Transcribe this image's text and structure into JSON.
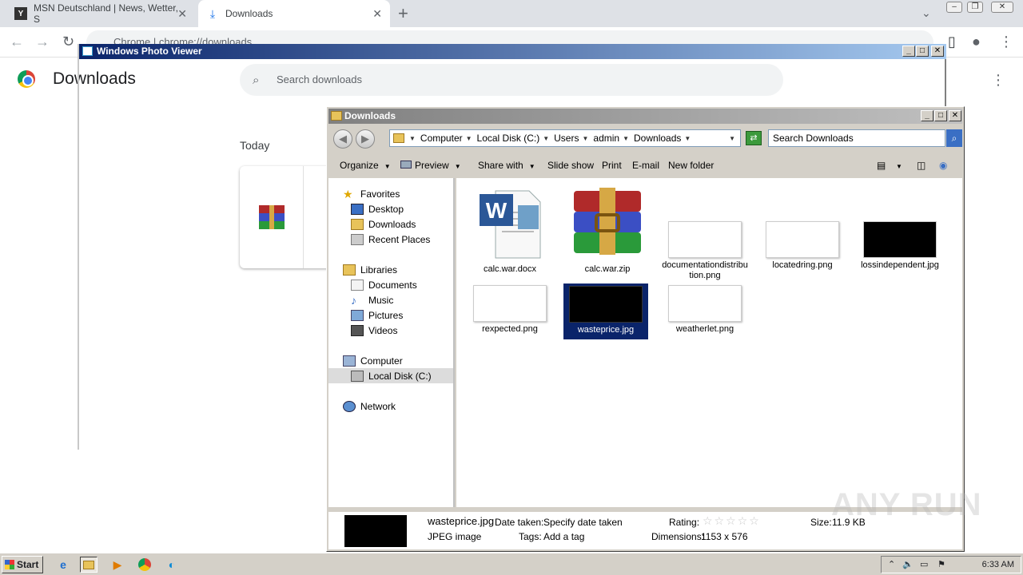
{
  "browser": {
    "tabs": [
      {
        "title": "MSN Deutschland | News, Wetter, S",
        "active": false
      },
      {
        "title": "Downloads",
        "active": true
      }
    ],
    "url": "Chrome  |  chrome://downloads"
  },
  "downloads_page": {
    "title": "Downloads",
    "search_placeholder": "Search downloads",
    "section": "Today"
  },
  "photo_viewer": {
    "title": "Windows Photo Viewer"
  },
  "explorer": {
    "title": "Downloads",
    "breadcrumbs": [
      "Computer",
      "Local Disk (C:)",
      "Users",
      "admin",
      "Downloads"
    ],
    "search_placeholder": "Search Downloads",
    "commands": [
      "Organize",
      "Preview",
      "Share with",
      "Slide show",
      "Print",
      "E-mail",
      "New folder"
    ],
    "nav": {
      "favorites": "Favorites",
      "desktop": "Desktop",
      "downloads": "Downloads",
      "recent": "Recent Places",
      "libraries": "Libraries",
      "documents": "Documents",
      "music": "Music",
      "pictures": "Pictures",
      "videos": "Videos",
      "computer": "Computer",
      "localdisk": "Local Disk (C:)",
      "network": "Network"
    },
    "files": [
      {
        "name": "calc.war.docx",
        "kind": "word"
      },
      {
        "name": "calc.war.zip",
        "kind": "rar"
      },
      {
        "name": "documentationdistribution.png",
        "kind": "white"
      },
      {
        "name": "locatedring.png",
        "kind": "white"
      },
      {
        "name": "lossindependent.jpg",
        "kind": "black"
      },
      {
        "name": "rexpected.png",
        "kind": "white"
      },
      {
        "name": "wasteprice.jpg",
        "kind": "black",
        "selected": true
      },
      {
        "name": "weatherlet.png",
        "kind": "white"
      }
    ],
    "details": {
      "filename": "wasteprice.jpg",
      "filetype": "JPEG image",
      "date_taken_label": "Date taken:",
      "date_taken_value": "Specify date taken",
      "tags_label": "Tags:",
      "tags_value": "Add a tag",
      "rating_label": "Rating:",
      "rating": 0,
      "dimensions_label": "Dimensions:",
      "dimensions_value": "1153 x 576",
      "size_label": "Size:",
      "size_value": "11.9 KB"
    }
  },
  "watermark": "ANY RUN",
  "taskbar": {
    "start_label": "Start",
    "clock": "6:33 AM"
  }
}
